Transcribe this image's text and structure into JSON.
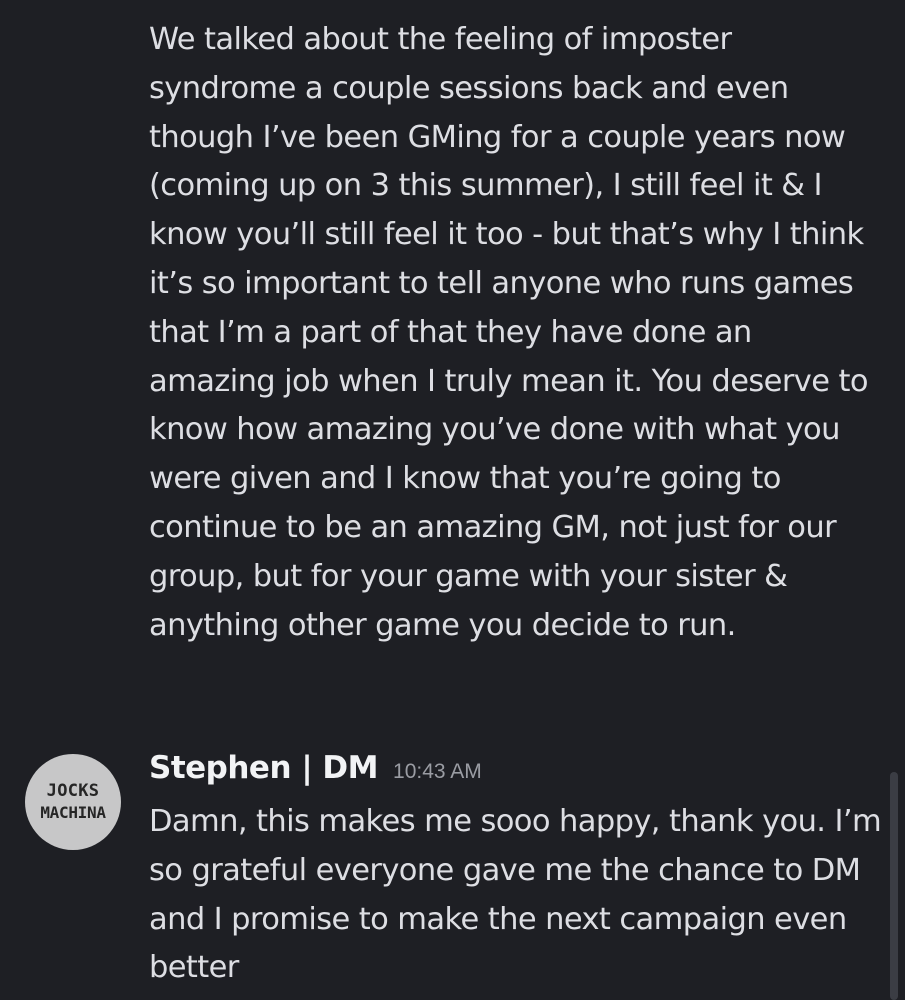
{
  "messages": {
    "continuation": {
      "text": "We talked about the feeling of imposter syndrome a couple sessions back and even though I’ve been GMing for a couple years now (coming up on 3 this summer), I still feel it & I know you’ll still feel it too - but that’s why I think it’s so important to tell anyone who runs games that I’m a part of that they have done an amazing job when I truly mean it. You deserve to know how amazing you’ve done with what you were given and I know that you’re going to continue to be an amazing GM, not just for our group, but for your game with your sister & anything other game you decide to run."
    },
    "reply": {
      "avatar_line1": "JOCKS",
      "avatar_line2": "MACHINA",
      "username": "Stephen | DM",
      "timestamp": "10:43 AM",
      "text": "Damn, this makes me sooo happy, thank you. I’m so grateful everyone gave me the chance to DM and I promise to make the next campaign even better"
    }
  },
  "colors": {
    "background": "#1e1f24",
    "text": "#dddee3",
    "username": "#f2f3f5",
    "timestamp": "#9a9ca3",
    "avatar_bg": "#c7c7c8"
  }
}
